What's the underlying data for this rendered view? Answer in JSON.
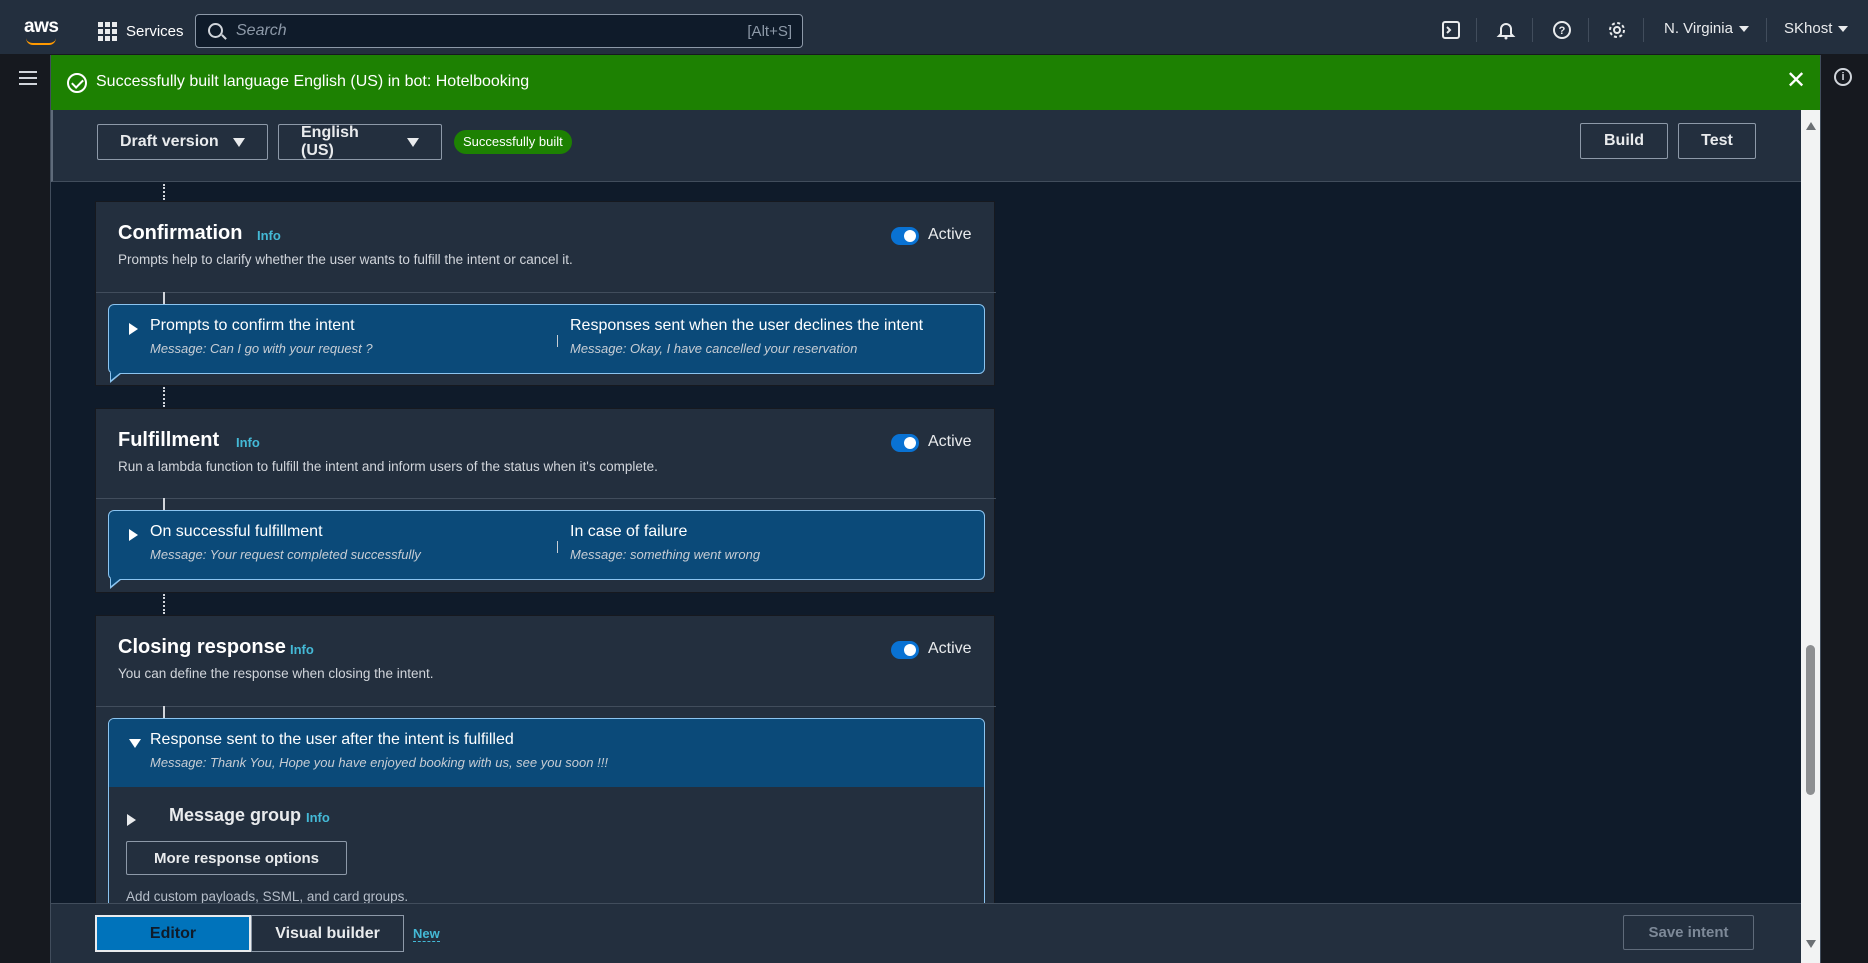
{
  "topnav": {
    "logo_text": "aws",
    "services_label": "Services",
    "search_placeholder": "Search",
    "search_shortcut": "[Alt+S]",
    "region": "N. Virginia",
    "account": "SKhost",
    "icons": [
      "cloudshell-icon",
      "bell-icon",
      "help-icon",
      "settings-icon"
    ]
  },
  "flash": {
    "message": "Successfully built language English (US) in bot: Hotelbooking",
    "color": "#1d8102"
  },
  "header": {
    "version_dropdown": "Draft version",
    "language_dropdown": "English (US)",
    "status_badge": "Successfully built",
    "build_button": "Build",
    "test_button": "Test"
  },
  "sections": {
    "confirmation": {
      "title": "Confirmation",
      "info": "Info",
      "description": "Prompts help to clarify whether the user wants to fulfill the intent or cancel it.",
      "toggle_label": "Active",
      "left_heading": "Prompts to confirm the intent",
      "left_message": "Message: Can I go with your request ?",
      "right_heading": "Responses sent when the user declines the intent",
      "right_message": "Message: Okay, I have cancelled your reservation"
    },
    "fulfillment": {
      "title": "Fulfillment",
      "info": "Info",
      "description": "Run a lambda function to fulfill the intent and inform users of the status when it's complete.",
      "toggle_label": "Active",
      "left_heading": "On successful fulfillment",
      "left_message": "Message: Your request completed successfully",
      "right_heading": "In case of failure",
      "right_message": "Message: something went wrong"
    },
    "closing": {
      "title": "Closing response",
      "info": "Info",
      "description": "You can define the response when closing the intent.",
      "toggle_label": "Active",
      "response_heading": "Response sent to the user after the intent is fulfilled",
      "response_message": "Message: Thank You, Hope you have enjoyed booking with us, see you soon !!!",
      "message_group_title": "Message group",
      "message_group_info": "Info",
      "more_options_button": "More response options",
      "more_options_desc": "Add custom payloads, SSML, and card groups."
    }
  },
  "bottombar": {
    "tab_editor": "Editor",
    "tab_visual_builder": "Visual builder",
    "new_tag": "New",
    "save_button": "Save intent"
  },
  "colors": {
    "accent_blue": "#0073bb",
    "toggle_on": "#0972d3",
    "link": "#44b9d6",
    "bubble_bg": "#0b4a79"
  }
}
